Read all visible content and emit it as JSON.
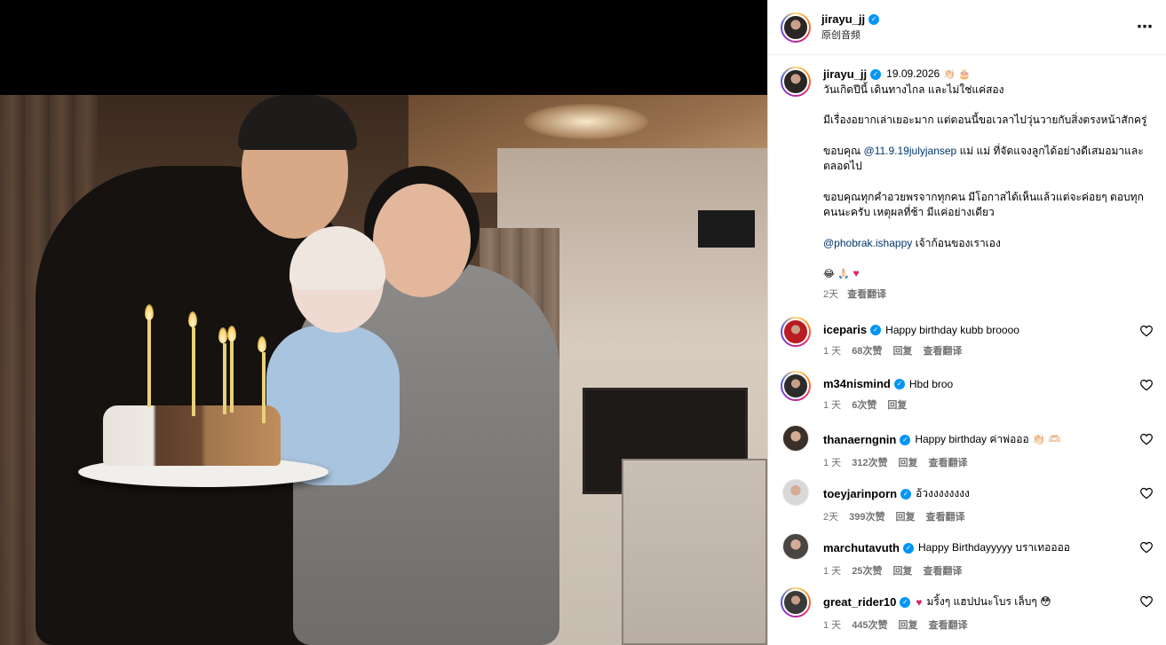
{
  "post_header": {
    "username": "jirayu_jj",
    "subtitle": "原创音频",
    "more_icon": "⋯"
  },
  "caption": {
    "username": "jirayu_jj",
    "date": "19.09.2026",
    "date_emoji": "👏🏻 🎂",
    "line1": "วันเกิดปีนี้ เดินทางไกล และไม่ใช่แค่สอง",
    "line2": "มีเรื่องอยากเล่าเยอะมาก แต่ตอนนี้ขอเวลาไปวุ่นวายกับสิ่งตรงหน้าสักครู่",
    "line3_pre": "ขอบคุณ ",
    "line3_mention": "@11.9.19julyjansep",
    "line3_post": " แม่ แม่ ที่จัดแจงลูกได้อย่างดีเสมอมาและตลอดไป",
    "line4": "ขอบคุณทุกคำอวยพรจากทุกคน มีโอกาสได้เห็นแล้วแต่จะค่อยๆ ตอบทุกคนนะครับ เหตุผลที่ช้า มีแค่อย่างเดียว",
    "line5_mention": "@phobrak.ishappy",
    "line5_post": " เจ้าก้อนของเราเอง",
    "emojis": "😂 🙏🏻 ",
    "emoji_heart": "♥",
    "time": "2天",
    "see_translation": "查看翻译"
  },
  "comments": [
    {
      "username": "iceparis",
      "text": "Happy birthday kubb broooo",
      "time": "1 天",
      "likes": "68次赞",
      "reply": "回复",
      "translate": "查看翻译",
      "has_ring": true,
      "avatar_color": "#b81d24"
    },
    {
      "username": "m34nismind",
      "text": "Hbd broo",
      "time": "1 天",
      "likes": "6次赞",
      "reply": "回复",
      "translate": "",
      "has_ring": true,
      "avatar_color": "#2c2c2c"
    },
    {
      "username": "thanaerngnin",
      "text": "Happy birthday ค่าพ่อออ 👏🏻 🫶🏻",
      "time": "1 天",
      "likes": "312次赞",
      "reply": "回复",
      "translate": "查看翻译",
      "has_ring": false,
      "avatar_color": "#3b2f2a"
    },
    {
      "username": "toeyjarinporn",
      "text": "อ้วงงงงงงงง",
      "time": "2天",
      "likes": "399次赞",
      "reply": "回复",
      "translate": "查看翻译",
      "has_ring": false,
      "avatar_color": "#d8d8d8"
    },
    {
      "username": "marchutavuth",
      "text": "Happy Birthdayyyyy บราเทออออ",
      "time": "1 天",
      "likes": "25次赞",
      "reply": "回复",
      "translate": "查看翻译",
      "has_ring": false,
      "avatar_color": "#4a4442"
    },
    {
      "username": "great_rider10",
      "text": "มริ้งๆ แฮปปนะโบร เล็บๆ 😳",
      "time": "1 天",
      "likes": "445次赞",
      "reply": "回复",
      "translate": "查看翻译",
      "has_ring": true,
      "avatar_color": "#3a3a3a",
      "lead_heart": "♥"
    }
  ],
  "colors": {
    "link": "#00376b",
    "verified": "#0095f6",
    "meta": "#737373"
  }
}
